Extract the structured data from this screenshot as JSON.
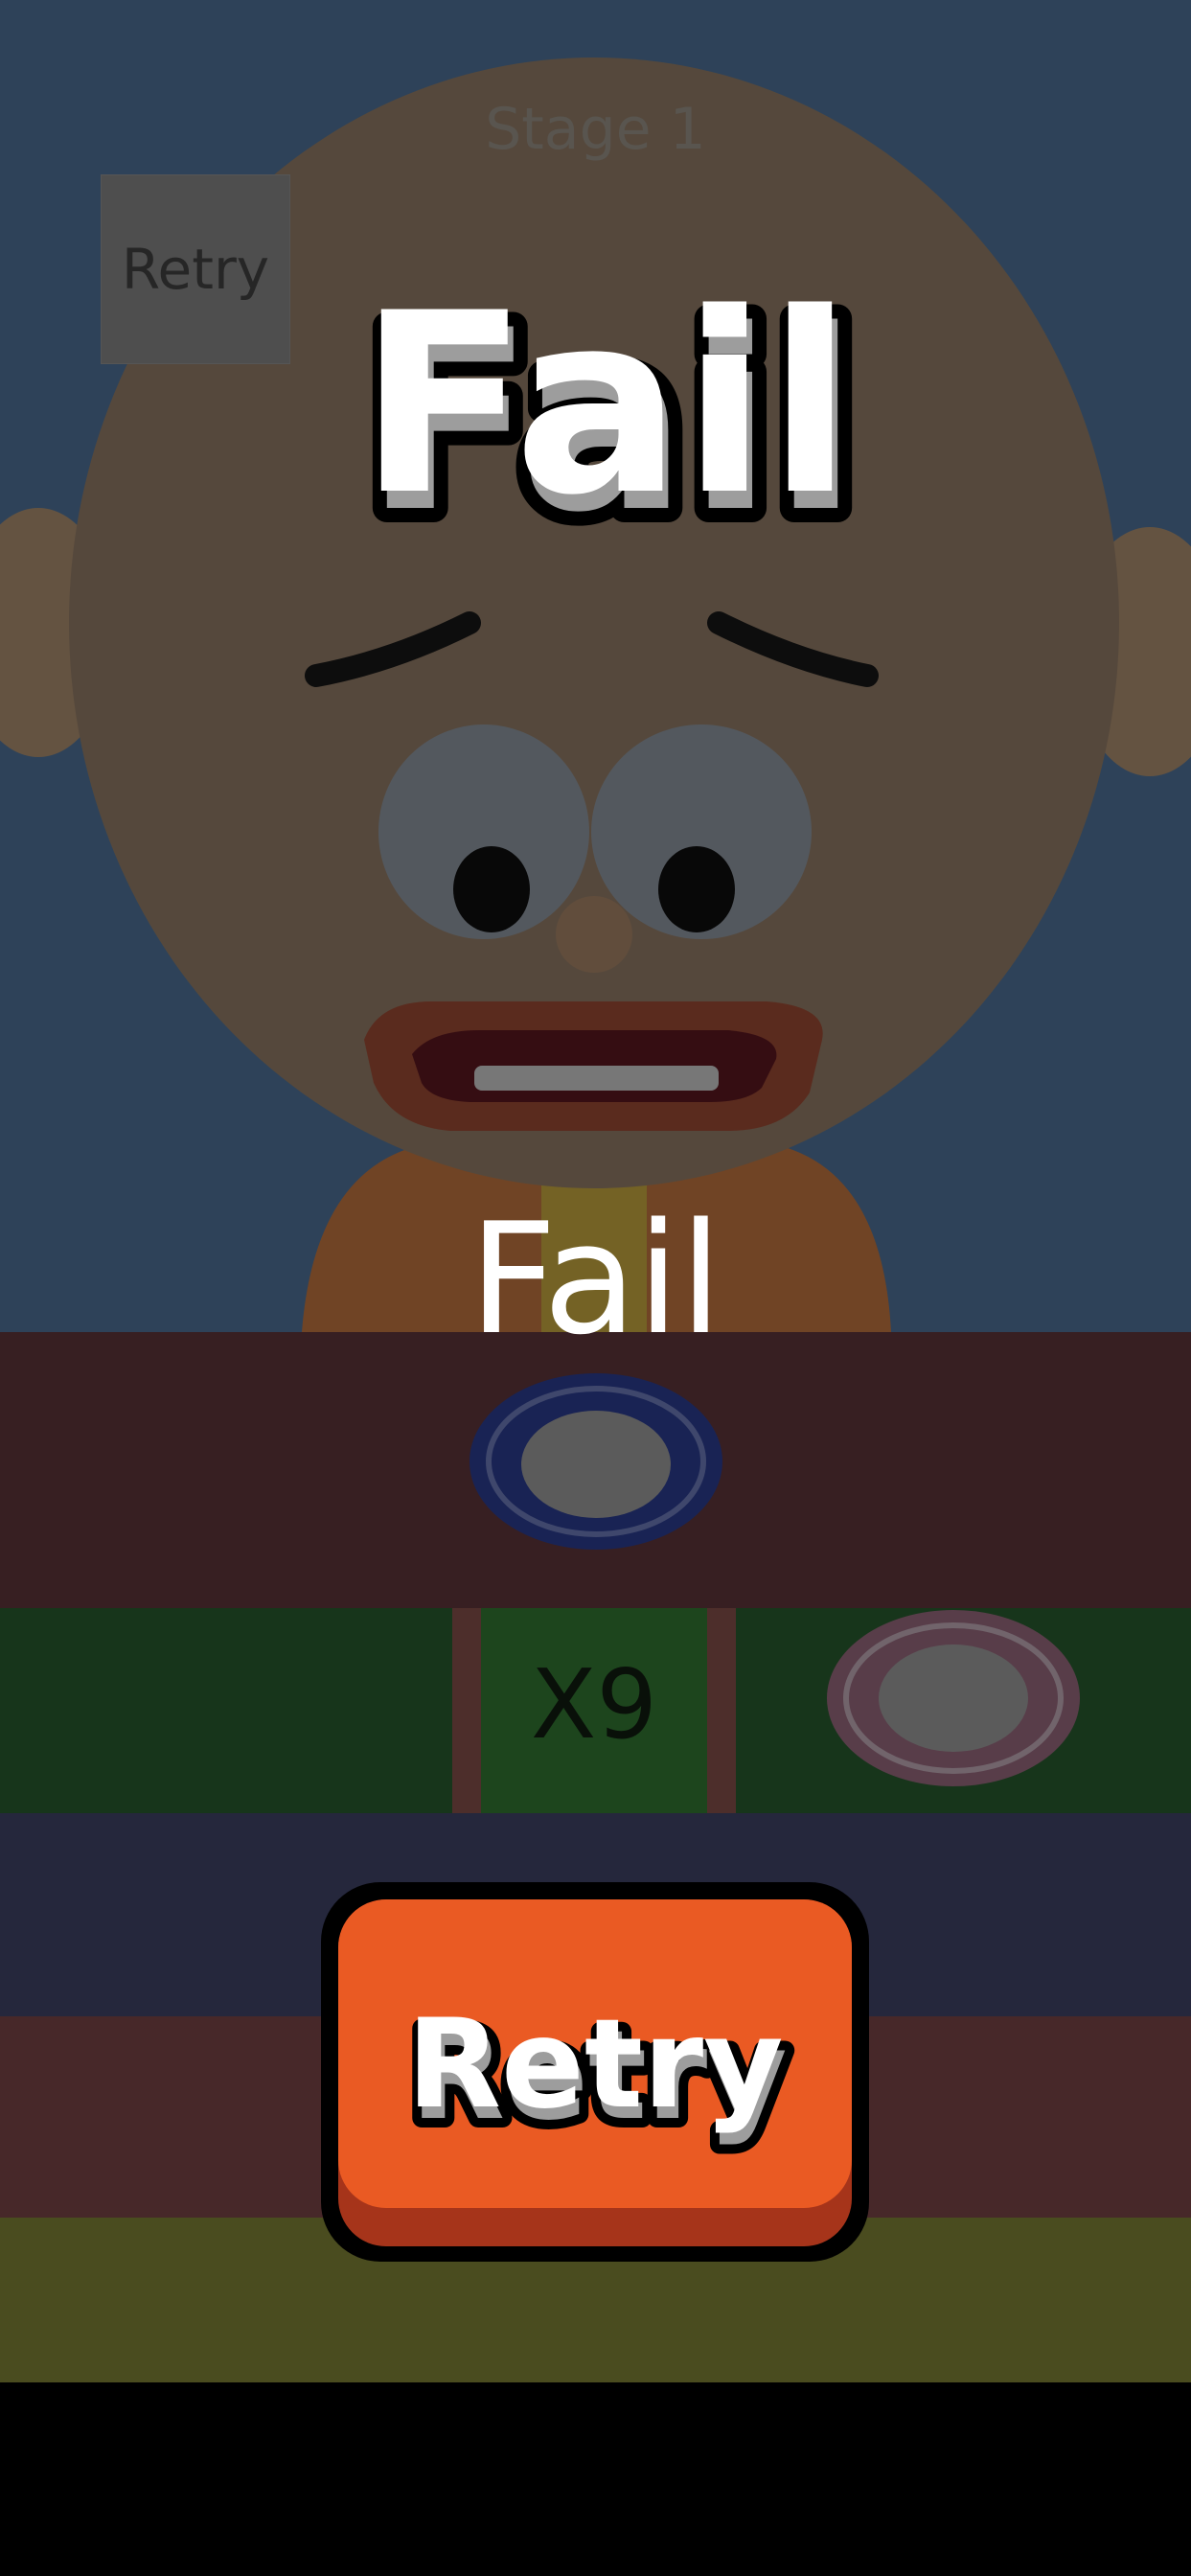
{
  "game": {
    "stage_label": "Stage 1",
    "retry_small_label": "Retry",
    "multiplier_label": "X9",
    "result_title": "Fail",
    "result_subtitle": "Fail",
    "retry_button_label": "Retry"
  },
  "colors": {
    "background_blue": "#5b86b5",
    "skin": "#f0c8a0",
    "lane_red": "#6b3a3a",
    "lane_green": "#2f7a2f",
    "lane_navy": "#414f85",
    "lane_maroon": "#8a4a4a",
    "lane_olive": "#8c9a3a",
    "retry_button": "#ea5a23",
    "retry_button_shadow": "#a6341a"
  }
}
